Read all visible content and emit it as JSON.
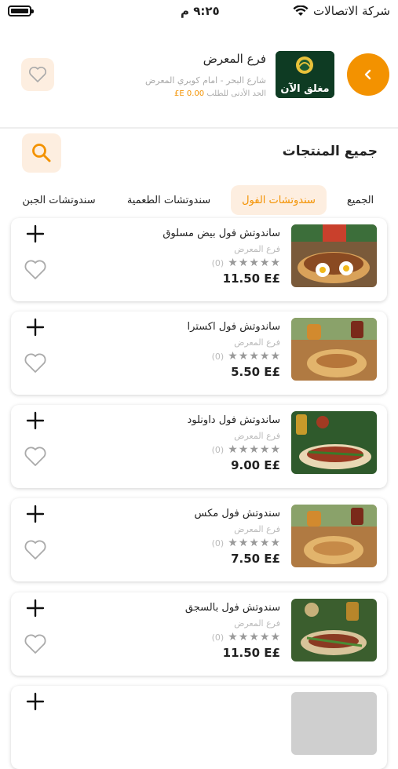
{
  "status": {
    "time": "٩:٢٥ م",
    "carrier": "شركة الاتصالات"
  },
  "branch": {
    "name": "فرع المعرض",
    "address": "شارع البحر - امام كوبري المعرض",
    "min_label": "الحد الأدنى للطلب",
    "min_amount": "0.00 E£",
    "closed_label": "مغلق الآن"
  },
  "section": {
    "title": "جميع المنتجات"
  },
  "tabs": [
    {
      "label": "الجميع"
    },
    {
      "label": "سندوتشات الفول"
    },
    {
      "label": "سندوتشات الطعمية"
    },
    {
      "label": "سندوتشات الجبن"
    }
  ],
  "active_tab": "سندوتشات الفول",
  "accent_color": "#f39200",
  "products": [
    {
      "name": "ساندوتش فول بيض مسلوق",
      "branch": "فرع المعرض",
      "rating_count": "(0)",
      "price": "11.50 E£"
    },
    {
      "name": "ساندوتش فول اكسترا",
      "branch": "فرع المعرض",
      "rating_count": "(0)",
      "price": "5.50 E£"
    },
    {
      "name": "ساندوتش فول داونلود",
      "branch": "فرع المعرض",
      "rating_count": "(0)",
      "price": "9.00 E£"
    },
    {
      "name": "سندوتش فول مكس",
      "branch": "فرع المعرض",
      "rating_count": "(0)",
      "price": "7.50 E£"
    },
    {
      "name": "سندوتش فول بالسجق",
      "branch": "فرع المعرض",
      "rating_count": "(0)",
      "price": "11.50 E£"
    }
  ]
}
